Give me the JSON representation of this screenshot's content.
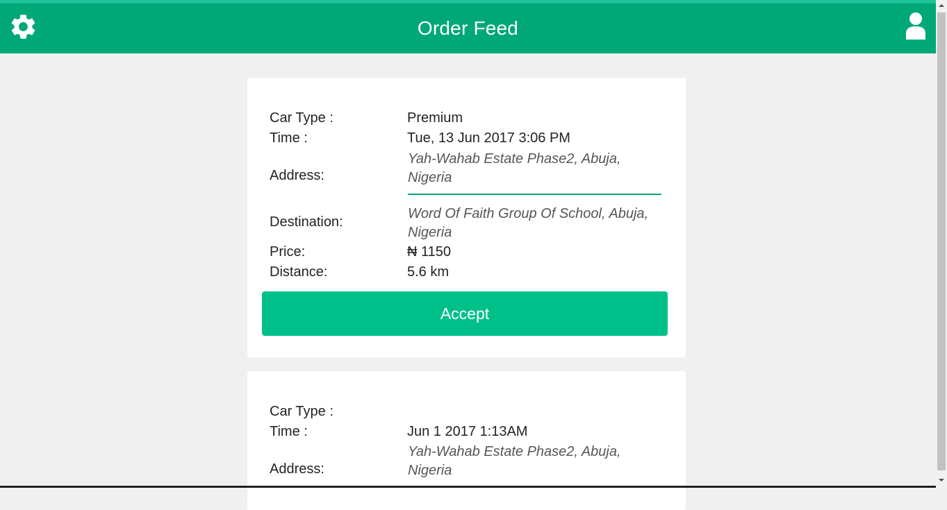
{
  "header": {
    "title": "Order Feed"
  },
  "colors": {
    "primary": "#00a878",
    "accent_button": "#00c08a"
  },
  "orders": [
    {
      "car_type_label": "Car Type :",
      "car_type": "Premium",
      "time_label": "Time :",
      "time": "Tue, 13 Jun 2017 3:06 PM",
      "address_label": "Address:",
      "address_line1": "Yah-Wahab Estate Phase2, Abuja,",
      "address_line2": "Nigeria",
      "destination_label": "Destination:",
      "destination_line1": "Word Of Faith Group Of School, Abuja,",
      "destination_line2": "Nigeria",
      "price_label": "Price:",
      "price": "₦ 1150",
      "distance_label": "Distance:",
      "distance": "5.6 km",
      "accept_label": "Accept"
    },
    {
      "car_type_label": "Car Type :",
      "car_type": "",
      "time_label": "Time :",
      "time": "Jun 1 2017 1:13AM",
      "address_label": "Address:",
      "address_line1": "Yah-Wahab Estate Phase2, Abuja,",
      "address_line2": "Nigeria"
    }
  ],
  "icons": {
    "settings": "gear-icon",
    "profile": "user-icon"
  }
}
